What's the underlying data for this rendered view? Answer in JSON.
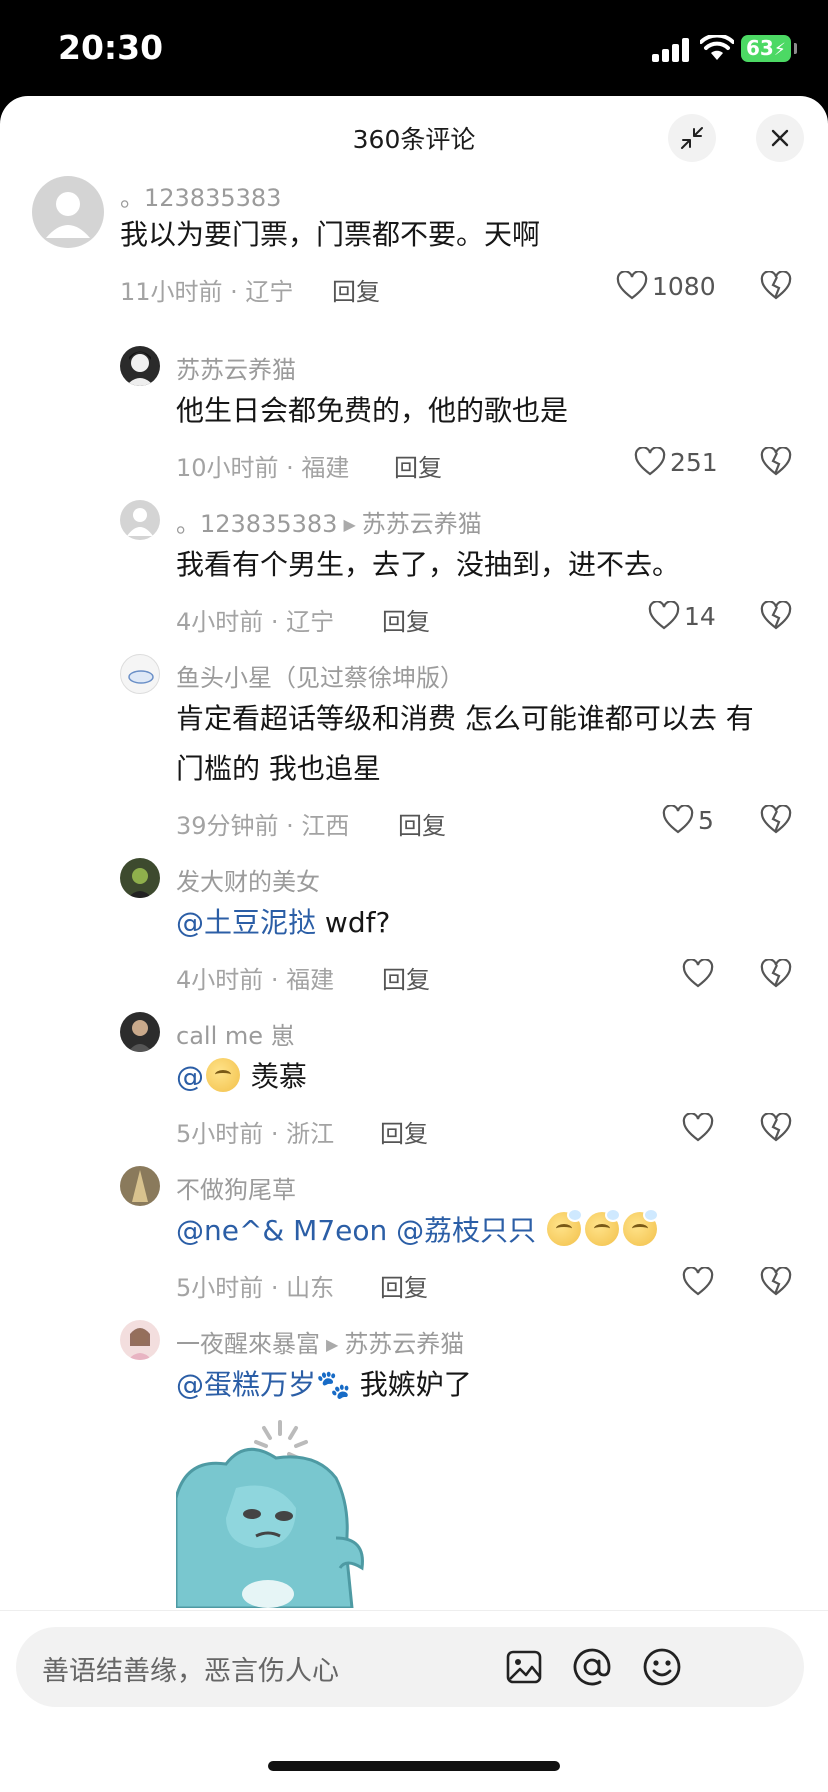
{
  "status_bar": {
    "time": "20:30",
    "battery": "63"
  },
  "sheet": {
    "title": "360条评论"
  },
  "comments": [
    {
      "user": "。123835383",
      "text": "我以为要门票，门票都不要。天啊",
      "meta": "11小时前 · 辽宁",
      "reply": "回复",
      "likes": "1080"
    },
    {
      "user": "苏苏云养猫",
      "text": "他生日会都免费的，他的歌也是",
      "meta": "10小时前 · 福建",
      "reply": "回复",
      "likes": "251"
    },
    {
      "user": "。123835383",
      "reply_to": "苏苏云养猫",
      "text": "我看有个男生，去了，没抽到，进不去。",
      "meta": "4小时前 · 辽宁",
      "reply": "回复",
      "likes": "14"
    },
    {
      "user": "鱼头小星（见过蔡徐坤版）",
      "text_line1": "肯定看超话等级和消费 怎么可能谁都可以去 有",
      "text_line2": "门槛的 我也追星",
      "meta": "39分钟前 · 江西",
      "reply": "回复",
      "likes": "5"
    },
    {
      "user": "发大财的美女",
      "mention": "@土豆泥挞",
      "text": " wdf?",
      "meta": "4小时前 · 福建",
      "reply": "回复",
      "likes": ""
    },
    {
      "user": "call me 崽",
      "mention": "@",
      "text": " 羡慕",
      "meta": "5小时前 · 浙江",
      "reply": "回复",
      "likes": ""
    },
    {
      "user": "不做狗尾草",
      "mention": "@ne^& M7eon @荔枝只只",
      "text": " ",
      "meta": "5小时前 · 山东",
      "reply": "回复",
      "likes": ""
    },
    {
      "user": "一夜醒來暴富",
      "reply_to": "苏苏云养猫",
      "mention": "@蛋糕万岁",
      "text": " 我嫉妒了"
    }
  ],
  "input": {
    "placeholder": "善语结善缘，恶言伤人心"
  },
  "icons": [
    "collapse-icon",
    "close-icon",
    "heart-icon",
    "dislike-heart-icon",
    "image-icon",
    "at-icon",
    "emoji-icon"
  ],
  "colors": {
    "mention": "#2b5ea6",
    "battery": "#4cd964"
  }
}
